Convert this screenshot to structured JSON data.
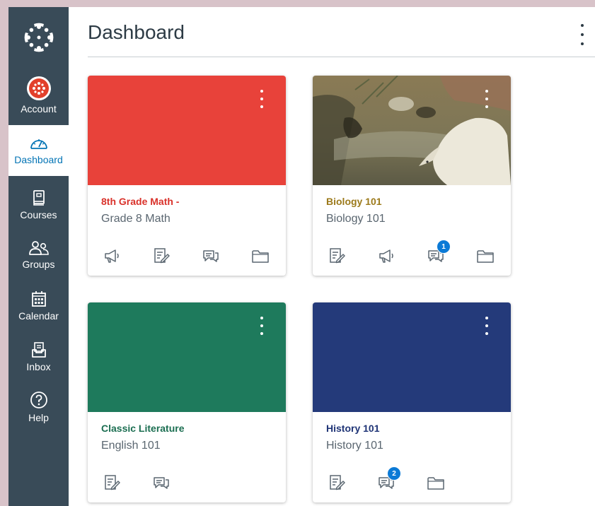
{
  "page": {
    "title": "Dashboard"
  },
  "nav": {
    "account": "Account",
    "dashboard": "Dashboard",
    "courses": "Courses",
    "groups": "Groups",
    "calendar": "Calendar",
    "inbox": "Inbox",
    "help": "Help"
  },
  "colors": {
    "sidebar": "#394b58",
    "active_nav": "#0374b5",
    "badge": "#0b7ad6"
  },
  "cards": [
    {
      "title": "8th Grade Math -",
      "subtitle": "Grade 8 Math",
      "color": "#e8423a",
      "title_color": "#d9322b",
      "icons": [
        "announcements-icon",
        "assignments-icon",
        "discussions-icon",
        "files-icon"
      ]
    },
    {
      "title": "Biology 101",
      "subtitle": "Biology 101",
      "title_color": "#9c7a1b",
      "image": "polar-bear-seal-illustration",
      "icons": [
        "assignments-icon",
        "announcements-icon",
        "discussions-icon",
        "files-icon"
      ],
      "discussion_badge": "1"
    },
    {
      "title": "Classic Literature",
      "subtitle": "English 101",
      "color": "#1e7a5c",
      "title_color": "#1b6e51",
      "icons": [
        "assignments-icon",
        "discussions-icon"
      ]
    },
    {
      "title": "History 101",
      "subtitle": "History 101",
      "color": "#243a7a",
      "title_color": "#1f3476",
      "icons": [
        "assignments-icon",
        "discussions-icon",
        "files-icon"
      ],
      "discussion_badge": "2"
    }
  ]
}
